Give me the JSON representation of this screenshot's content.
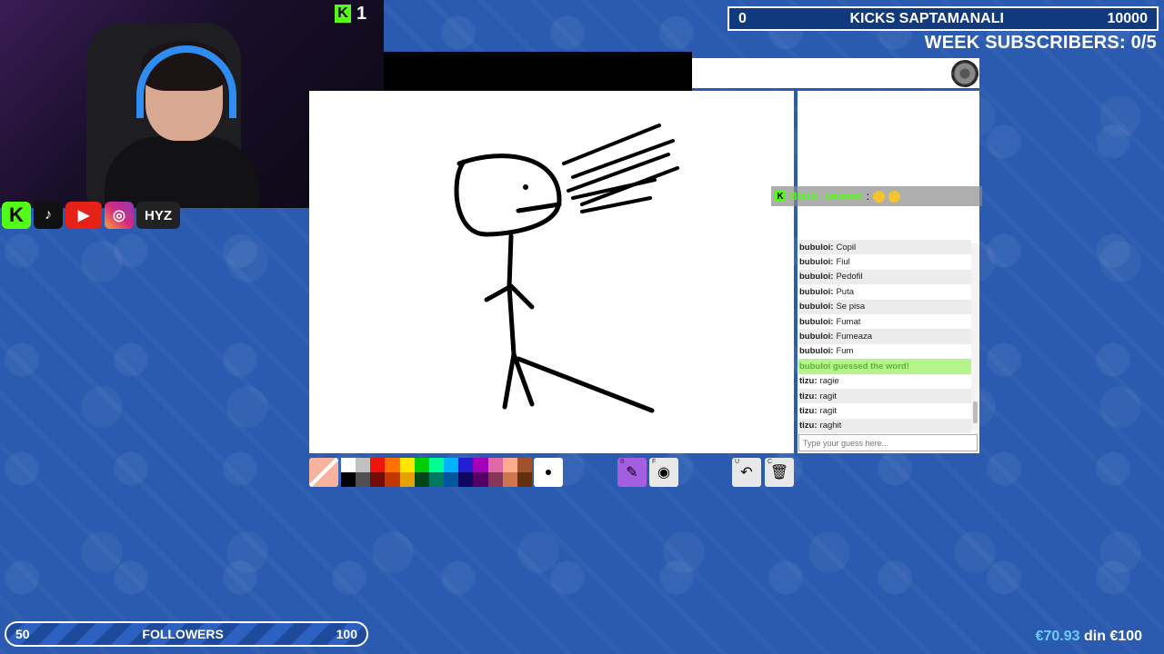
{
  "webcam": {
    "kick_count": "1"
  },
  "socials": [
    "K",
    "♪",
    "▶",
    "◎",
    "HYZ"
  ],
  "kicks_bar": {
    "left": "0",
    "title": "KICKS SAPTAMANALI",
    "right": "10000"
  },
  "week_subscribers": "WEEK SUBSCRIBERS: 0/5",
  "highlight": {
    "user": "Black_catemo",
    "text": ":"
  },
  "chat": [
    {
      "user": "bubuloi:",
      "msg": "Copil"
    },
    {
      "user": "bubuloi:",
      "msg": "Fiul"
    },
    {
      "user": "bubuloi:",
      "msg": "Pedofil"
    },
    {
      "user": "bubuloi:",
      "msg": "Puta"
    },
    {
      "user": "bubuloi:",
      "msg": "Se pisa"
    },
    {
      "user": "bubuloi:",
      "msg": "Fumat"
    },
    {
      "user": "bubuloi:",
      "msg": "Fumeaza"
    },
    {
      "user": "bubuloi:",
      "msg": "Fum"
    },
    {
      "user": "",
      "msg": "bubuloi guessed the word!",
      "guess": true
    },
    {
      "user": "tizu:",
      "msg": "ragie"
    },
    {
      "user": "tizu:",
      "msg": "ragit"
    },
    {
      "user": "tizu:",
      "msg": "ragit"
    },
    {
      "user": "tizu:",
      "msg": "raghit"
    }
  ],
  "guess_input": {
    "placeholder": "Type your guess here..."
  },
  "palette": [
    "#ffffff",
    "#c1c1c1",
    "#ef130b",
    "#ff7100",
    "#ffe400",
    "#00cc00",
    "#00ff91",
    "#00b2ff",
    "#231fd3",
    "#a300ba",
    "#df69a7",
    "#ffac8e",
    "#a0522d",
    "#000000",
    "#505050",
    "#740b07",
    "#c23800",
    "#e8a200",
    "#004619",
    "#00785d",
    "#00569e",
    "#0e0865",
    "#550069",
    "#873554",
    "#cc774d",
    "#63300d"
  ],
  "tools": {
    "pen_key": "B",
    "fill_key": "F",
    "undo_key": "U",
    "clear_key": "C"
  },
  "followers": {
    "current": "50",
    "label": "FOLLOWERS",
    "goal": "100"
  },
  "donation": {
    "amount": "€70.93",
    "text": "din €100"
  },
  "colors": {
    "kick_green": "#53fc18",
    "background_blue": "#2a5bb0"
  }
}
